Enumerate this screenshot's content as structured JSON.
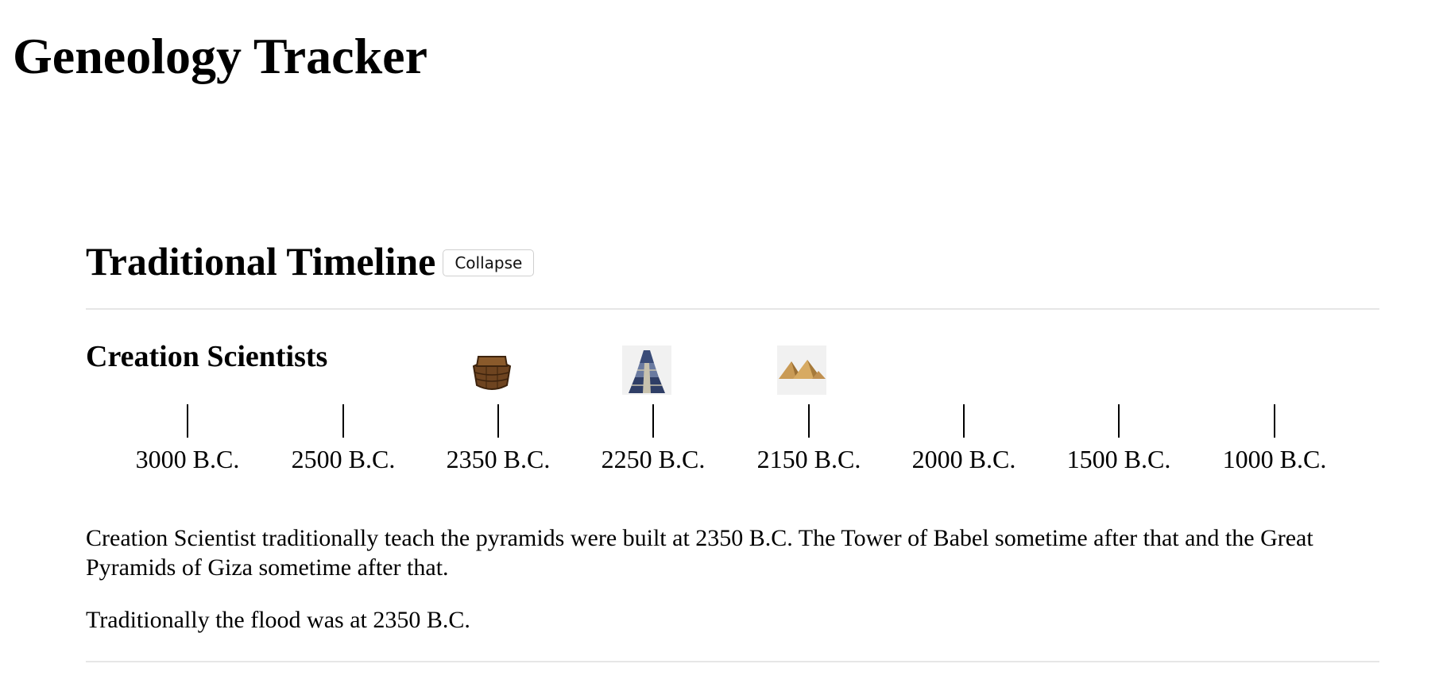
{
  "page": {
    "title": "Geneology Tracker"
  },
  "timeline": {
    "title": "Traditional Timeline",
    "collapse_label": "Collapse",
    "group_title": "Creation Scientists",
    "ticks": [
      "3000 B.C.",
      "2500 B.C.",
      "2350 B.C.",
      "2250 B.C.",
      "2150 B.C.",
      "2000 B.C.",
      "1500 B.C.",
      "1000 B.C."
    ],
    "events": [
      {
        "icon": "ark-icon",
        "tick": "2350 B.C."
      },
      {
        "icon": "tower-of-babel-icon",
        "tick": "2250 B.C."
      },
      {
        "icon": "pyramids-icon",
        "tick": "2150 B.C."
      }
    ],
    "paragraphs": [
      "Creation Scientist traditionally teach the pyramids were built at 2350 B.C. The Tower of Babel sometime after that and the Great Pyramids of Giza sometime after that.",
      "Traditionally the flood was at 2350 B.C."
    ]
  }
}
